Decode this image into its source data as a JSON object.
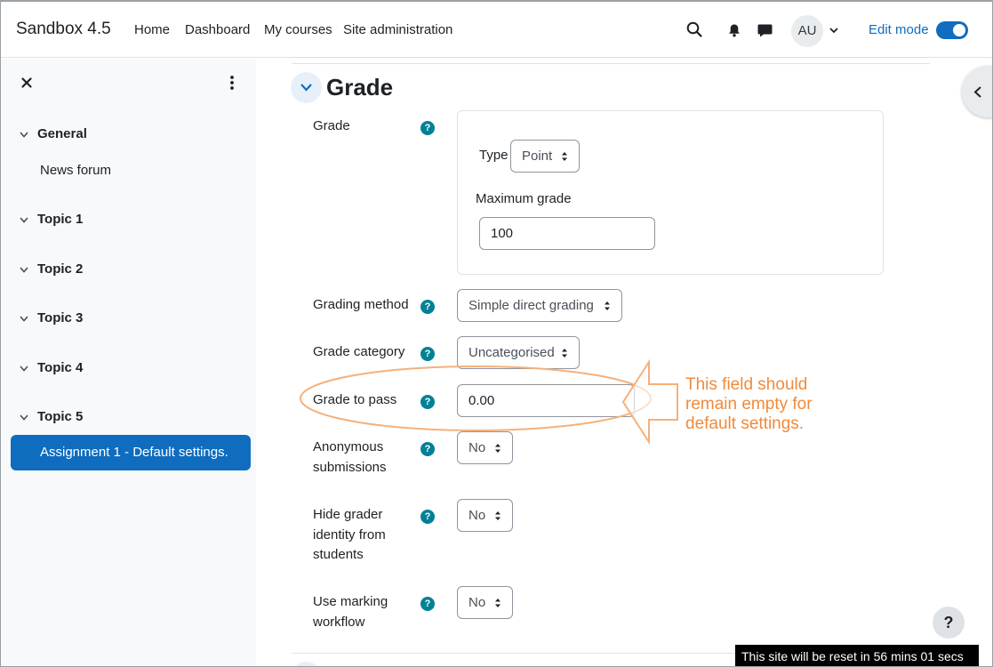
{
  "navbar": {
    "brand": "Sandbox 4.5",
    "links": [
      "Home",
      "Dashboard",
      "My courses",
      "Site administration"
    ],
    "avatar_initials": "AU",
    "edit_mode_label": "Edit mode",
    "edit_mode_on": true
  },
  "drawer": {
    "sections": [
      {
        "label": "General",
        "items": [
          "News forum"
        ]
      },
      {
        "label": "Topic 1",
        "items": []
      },
      {
        "label": "Topic 2",
        "items": []
      },
      {
        "label": "Topic 3",
        "items": []
      },
      {
        "label": "Topic 4",
        "items": []
      },
      {
        "label": "Topic 5",
        "items": [
          "Assignment 1 - Default settings."
        ]
      }
    ],
    "active_item": "Assignment 1 - Default settings."
  },
  "form": {
    "section_title": "Grade",
    "grade": {
      "label": "Grade",
      "type_label": "Type",
      "type_value": "Point",
      "max_grade_label": "Maximum grade",
      "max_grade_value": "100"
    },
    "grading_method": {
      "label": "Grading method",
      "value": "Simple direct grading"
    },
    "grade_category": {
      "label": "Grade category",
      "value": "Uncategorised"
    },
    "grade_to_pass": {
      "label": "Grade to pass",
      "value": "0.00"
    },
    "anonymous_submissions": {
      "label": "Anonymous submissions",
      "value": "No"
    },
    "hide_grader": {
      "label": "Hide grader identity from students",
      "value": "No"
    },
    "marking_workflow": {
      "label": "Use marking workflow",
      "value": "No"
    },
    "help_glyph": "?"
  },
  "annotation": {
    "text": "This field should remain empty for default settings.",
    "color": "#f08a3c"
  },
  "help_fab": "?",
  "reset_banner": "This site will be reset in 56 mins 01 secs",
  "colors": {
    "primary": "#0f6cbf",
    "help": "#008196",
    "annotation": "#f08a3c"
  }
}
